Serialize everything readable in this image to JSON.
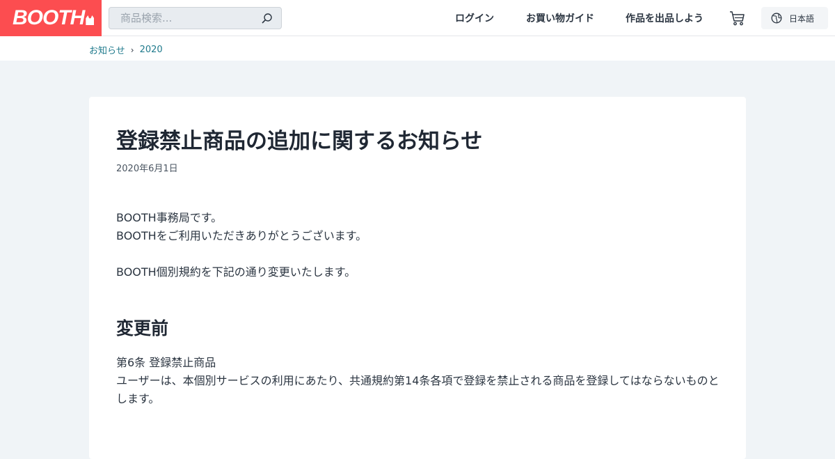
{
  "header": {
    "logo_text": "BOOTH",
    "search_placeholder": "商品検索...",
    "nav": {
      "login": "ログイン",
      "guide": "お買い物ガイド",
      "sell": "作品を出品しよう"
    },
    "language": "日本語",
    "brand_color": "#fc4d50"
  },
  "breadcrumb": {
    "items": [
      "お知らせ",
      "2020"
    ],
    "separator": "›"
  },
  "article": {
    "title": "登録禁止商品の追加に関するお知らせ",
    "date": "2020年6月1日",
    "intro_line1": "BOOTH事務局です。",
    "intro_line2": "BOOTHをご利用いただきありがとうございます。",
    "intro_line3": "BOOTH個別規約を下記の通り変更いたします。",
    "section_heading": "変更前",
    "section_line1": "第6条 登録禁止商品",
    "section_line2": "ユーザーは、本個別サービスの利用にあたり、共通規約第14条各項で登録を禁止される商品を登録してはならないものと",
    "section_line3": "します。"
  }
}
